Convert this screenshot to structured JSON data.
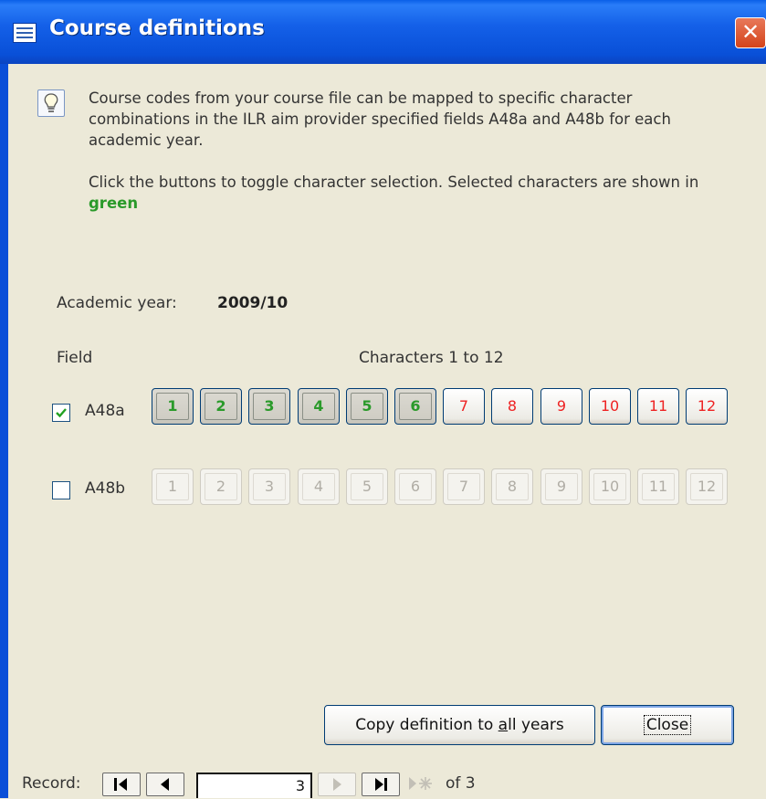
{
  "window": {
    "title": "Course definitions",
    "close_glyph": "✕"
  },
  "info": {
    "icon": "lightbulb-icon",
    "text1": "Course codes from your course file can be mapped to specific character combinations in the ILR aim provider specified fields A48a and A48b for each academic year.",
    "text2_prefix": "Click the buttons to toggle character selection. Selected characters are shown in ",
    "text2_green": "green"
  },
  "academic_year": {
    "label": "Academic year:",
    "value": "2009/10"
  },
  "grid": {
    "field_header": "Field",
    "chars_header": "Characters 1 to 12",
    "rows": [
      {
        "field": "A48a",
        "checked": true,
        "enabled": true,
        "buttons": [
          {
            "label": "1",
            "selected": true
          },
          {
            "label": "2",
            "selected": true
          },
          {
            "label": "3",
            "selected": true
          },
          {
            "label": "4",
            "selected": true
          },
          {
            "label": "5",
            "selected": true
          },
          {
            "label": "6",
            "selected": true
          },
          {
            "label": "7",
            "selected": false
          },
          {
            "label": "8",
            "selected": false
          },
          {
            "label": "9",
            "selected": false
          },
          {
            "label": "10",
            "selected": false
          },
          {
            "label": "11",
            "selected": false
          },
          {
            "label": "12",
            "selected": false
          }
        ]
      },
      {
        "field": "A48b",
        "checked": false,
        "enabled": false,
        "buttons": [
          {
            "label": "1",
            "selected": false
          },
          {
            "label": "2",
            "selected": false
          },
          {
            "label": "3",
            "selected": false
          },
          {
            "label": "4",
            "selected": false
          },
          {
            "label": "5",
            "selected": false
          },
          {
            "label": "6",
            "selected": false
          },
          {
            "label": "7",
            "selected": false
          },
          {
            "label": "8",
            "selected": false
          },
          {
            "label": "9",
            "selected": false
          },
          {
            "label": "10",
            "selected": false
          },
          {
            "label": "11",
            "selected": false
          },
          {
            "label": "12",
            "selected": false
          }
        ]
      }
    ]
  },
  "actions": {
    "copy_prefix": "Copy definition to ",
    "copy_underline": "a",
    "copy_suffix": "ll years",
    "close_label": "Close"
  },
  "record_nav": {
    "label": "Record:",
    "current": "3",
    "of_text": "of 3"
  },
  "colors": {
    "selected": "#2a9a2a",
    "unselected": "#ee2222",
    "titlebar": "#0a5fe8"
  }
}
